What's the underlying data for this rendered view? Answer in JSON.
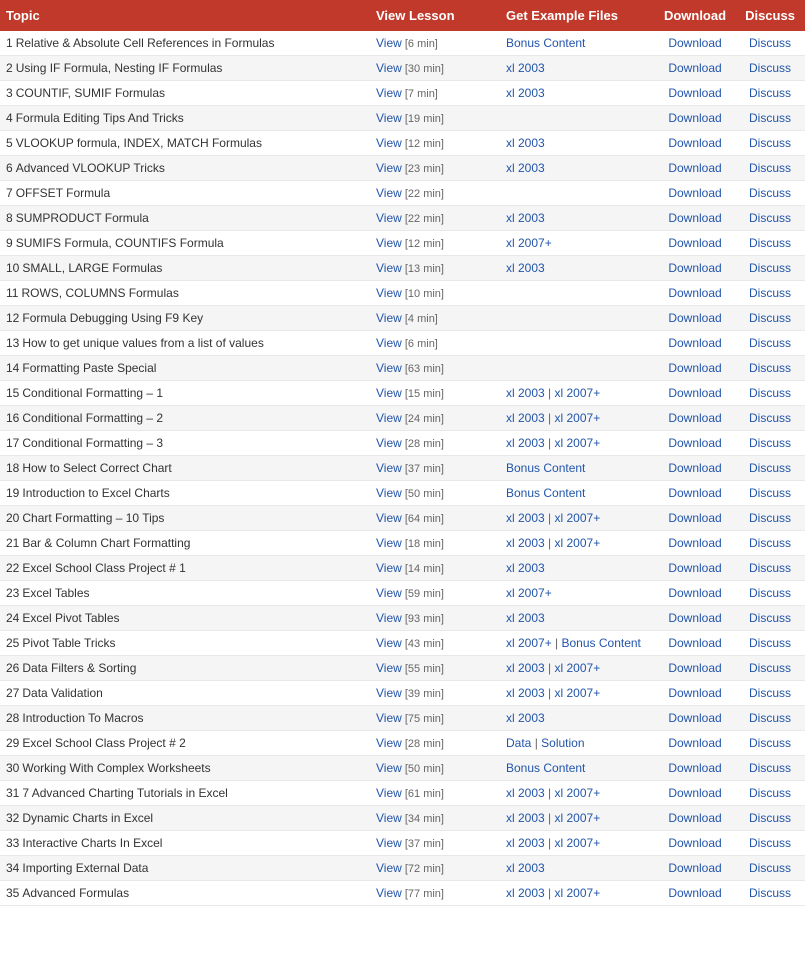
{
  "headers": {
    "topic": "Topic",
    "view": "View Lesson",
    "files": "Get Example Files",
    "download": "Download",
    "discuss": "Discuss"
  },
  "rows": [
    {
      "num": 1,
      "topic": "Relative & Absolute Cell References in Formulas",
      "viewMins": "6 min",
      "files": [
        {
          "label": "Bonus Content",
          "type": "bonus"
        }
      ],
      "hasDownload": true
    },
    {
      "num": 2,
      "topic": "Using IF Formula, Nesting IF Formulas",
      "viewMins": "30 min",
      "files": [
        {
          "label": "xl 2003",
          "type": "link"
        }
      ],
      "hasDownload": true
    },
    {
      "num": 3,
      "topic": "COUNTIF, SUMIF Formulas",
      "viewMins": "7 min",
      "files": [
        {
          "label": "xl 2003",
          "type": "link"
        }
      ],
      "hasDownload": true
    },
    {
      "num": 4,
      "topic": "Formula Editing Tips And Tricks",
      "viewMins": "19 min",
      "files": [],
      "hasDownload": true
    },
    {
      "num": 5,
      "topic": "VLOOKUP formula, INDEX, MATCH Formulas",
      "viewMins": "12 min",
      "files": [
        {
          "label": "xl 2003",
          "type": "link"
        }
      ],
      "hasDownload": true
    },
    {
      "num": 6,
      "topic": "Advanced VLOOKUP Tricks",
      "viewMins": "23 min",
      "files": [
        {
          "label": "xl 2003",
          "type": "link"
        }
      ],
      "hasDownload": true
    },
    {
      "num": 7,
      "topic": "OFFSET Formula",
      "viewMins": "22 min",
      "files": [],
      "hasDownload": true
    },
    {
      "num": 8,
      "topic": "SUMPRODUCT Formula",
      "viewMins": "22 min",
      "files": [
        {
          "label": "xl 2003",
          "type": "link"
        }
      ],
      "hasDownload": true
    },
    {
      "num": 9,
      "topic": "SUMIFS Formula, COUNTIFS Formula",
      "viewMins": "12 min",
      "files": [
        {
          "label": "xl 2007+",
          "type": "link"
        }
      ],
      "hasDownload": true
    },
    {
      "num": 10,
      "topic": "SMALL, LARGE Formulas",
      "viewMins": "13 min",
      "files": [
        {
          "label": "xl 2003",
          "type": "link"
        }
      ],
      "hasDownload": true
    },
    {
      "num": 11,
      "topic": "ROWS, COLUMNS Formulas",
      "viewMins": "10 min",
      "files": [],
      "hasDownload": true
    },
    {
      "num": 12,
      "topic": "Formula Debugging Using F9 Key",
      "viewMins": "4 min",
      "files": [],
      "hasDownload": true
    },
    {
      "num": 13,
      "topic": "How to get unique values from a list of values",
      "viewMins": "6 min",
      "files": [],
      "hasDownload": true
    },
    {
      "num": 14,
      "topic": "Formatting Paste Special",
      "viewMins": "63 min",
      "files": [],
      "hasDownload": true
    },
    {
      "num": 15,
      "topic": "Conditional Formatting – 1",
      "viewMins": "15 min",
      "files": [
        {
          "label": "xl 2003",
          "type": "link"
        },
        {
          "label": "xl 2007+",
          "type": "link"
        }
      ],
      "hasDownload": true
    },
    {
      "num": 16,
      "topic": "Conditional Formatting – 2",
      "viewMins": "24 min",
      "files": [
        {
          "label": "xl 2003",
          "type": "link"
        },
        {
          "label": "xl 2007+",
          "type": "link"
        }
      ],
      "hasDownload": true
    },
    {
      "num": 17,
      "topic": "Conditional Formatting – 3",
      "viewMins": "28 min",
      "files": [
        {
          "label": "xl 2003",
          "type": "link"
        },
        {
          "label": "xl 2007+",
          "type": "link"
        }
      ],
      "hasDownload": true
    },
    {
      "num": 18,
      "topic": "How to Select Correct Chart",
      "viewMins": "37 min",
      "files": [
        {
          "label": "Bonus Content",
          "type": "bonus"
        }
      ],
      "hasDownload": true
    },
    {
      "num": 19,
      "topic": "Introduction to Excel Charts",
      "viewMins": "50 min",
      "files": [
        {
          "label": "Bonus Content",
          "type": "bonus"
        }
      ],
      "hasDownload": true
    },
    {
      "num": 20,
      "topic": "Chart Formatting – 10 Tips",
      "viewMins": "64 min",
      "files": [
        {
          "label": "xl 2003",
          "type": "link"
        },
        {
          "label": "xl 2007+",
          "type": "link"
        }
      ],
      "hasDownload": true
    },
    {
      "num": 21,
      "topic": "Bar & Column Chart Formatting",
      "viewMins": "18 min",
      "files": [
        {
          "label": "xl 2003",
          "type": "link"
        },
        {
          "label": "xl 2007+",
          "type": "link"
        }
      ],
      "hasDownload": true
    },
    {
      "num": 22,
      "topic": "Excel School Class Project # 1",
      "viewMins": "14 min",
      "files": [
        {
          "label": "xl 2003",
          "type": "link"
        }
      ],
      "hasDownload": true
    },
    {
      "num": 23,
      "topic": "Excel Tables",
      "viewMins": "59 min",
      "files": [
        {
          "label": "xl 2007+",
          "type": "link"
        }
      ],
      "hasDownload": true
    },
    {
      "num": 24,
      "topic": "Excel Pivot Tables",
      "viewMins": "93 min",
      "files": [
        {
          "label": "xl 2003",
          "type": "link"
        }
      ],
      "hasDownload": true
    },
    {
      "num": 25,
      "topic": "Pivot Table Tricks",
      "viewMins": "43 min",
      "files": [
        {
          "label": "xl 2007+",
          "type": "link"
        },
        {
          "label": "Bonus Content",
          "type": "bonus"
        }
      ],
      "hasDownload": true
    },
    {
      "num": 26,
      "topic": "Data Filters & Sorting",
      "viewMins": "55 min",
      "files": [
        {
          "label": "xl 2003",
          "type": "link"
        },
        {
          "label": "xl 2007+",
          "type": "link"
        }
      ],
      "hasDownload": true
    },
    {
      "num": 27,
      "topic": "Data Validation",
      "viewMins": "39 min",
      "files": [
        {
          "label": "xl 2003",
          "type": "link"
        },
        {
          "label": "xl 2007+",
          "type": "link"
        }
      ],
      "hasDownload": true
    },
    {
      "num": 28,
      "topic": "Introduction To Macros",
      "viewMins": "75 min",
      "files": [
        {
          "label": "xl 2003",
          "type": "link"
        }
      ],
      "hasDownload": true
    },
    {
      "num": 29,
      "topic": "Excel School Class Project # 2",
      "viewMins": "28 min",
      "files": [
        {
          "label": "Data",
          "type": "link"
        },
        {
          "label": "Solution",
          "type": "link"
        }
      ],
      "hasDownload": true
    },
    {
      "num": 30,
      "topic": "Working With Complex Worksheets",
      "viewMins": "50 min",
      "files": [
        {
          "label": "Bonus Content",
          "type": "bonus"
        }
      ],
      "hasDownload": true
    },
    {
      "num": 31,
      "topic": "7 Advanced Charting Tutorials in Excel",
      "viewMins": "61 min",
      "files": [
        {
          "label": "xl 2003",
          "type": "link"
        },
        {
          "label": "xl 2007+",
          "type": "link"
        }
      ],
      "hasDownload": true
    },
    {
      "num": 32,
      "topic": "Dynamic Charts in Excel",
      "viewMins": "34 min",
      "files": [
        {
          "label": "xl 2003",
          "type": "link"
        },
        {
          "label": "xl 2007+",
          "type": "link"
        }
      ],
      "hasDownload": true
    },
    {
      "num": 33,
      "topic": "Interactive Charts In Excel",
      "viewMins": "37 min",
      "files": [
        {
          "label": "xl 2003",
          "type": "link"
        },
        {
          "label": "xl 2007+",
          "type": "link"
        }
      ],
      "hasDownload": true
    },
    {
      "num": 34,
      "topic": "Importing External Data",
      "viewMins": "72 min",
      "files": [
        {
          "label": "xl 2003",
          "type": "link"
        }
      ],
      "hasDownload": true
    },
    {
      "num": 35,
      "topic": "Advanced Formulas",
      "viewMins": "77 min",
      "files": [
        {
          "label": "xl 2003",
          "type": "link"
        },
        {
          "label": "xl 2007+",
          "type": "link"
        }
      ],
      "hasDownload": true
    }
  ],
  "labels": {
    "view": "View",
    "download": "Download",
    "discuss": "Discuss"
  }
}
